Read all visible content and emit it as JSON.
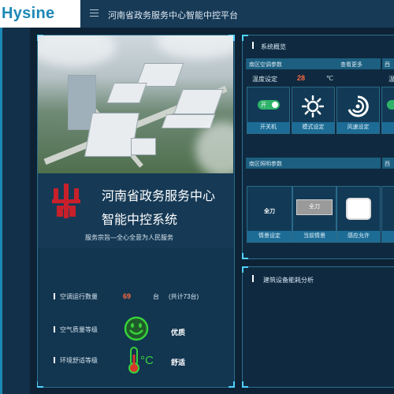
{
  "header": {
    "logo": "Hysine",
    "title": "河南省政务服务中心智能中控平台"
  },
  "left_card": {
    "org_name_line1": "河南省政务服务中心",
    "org_name_line2": "智能中控系统",
    "slogan": "服务宗旨—全心全意为人民服务",
    "stats": {
      "ac_label": "空调运行数量",
      "ac_value": "69",
      "ac_unit": "台",
      "ac_total": "(共计73台)",
      "air_label": "空气质量等级",
      "air_value": "优质",
      "comfort_label": "环境舒适等级",
      "comfort_value": "舒适"
    }
  },
  "overview": {
    "title": "系统概览",
    "ac_section": {
      "left_label": "南区空调参数",
      "right_label": "查看更多",
      "right_cut": "西",
      "temp_label": "温度设定",
      "temp_value": "28",
      "temp_unit": "℃",
      "cut_label": "温",
      "tiles": [
        {
          "caption": "开关机",
          "toggle_text": "开"
        },
        {
          "caption": "模式设定"
        },
        {
          "caption": "风速设定"
        }
      ]
    },
    "light_section": {
      "left_label": "南区照明参数",
      "right_cut": "西",
      "tiles": [
        {
          "caption": "情景设定",
          "inner": "全刀"
        },
        {
          "caption": "当前情景",
          "inner": "全刀"
        },
        {
          "caption": "感应允许"
        }
      ]
    }
  },
  "energy": {
    "title": "建筑设备能耗分析"
  },
  "colors": {
    "accent": "#1b88b5",
    "value_orange": "#ff6a3d",
    "good_green": "#37d13a"
  }
}
